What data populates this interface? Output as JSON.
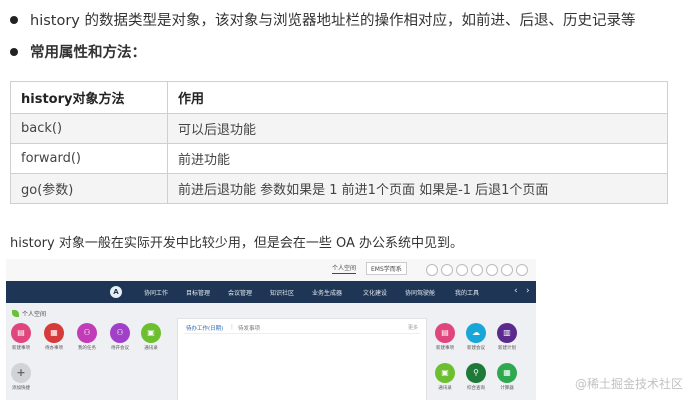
{
  "bullets": [
    "history 的数据类型是对象，该对象与浏览器地址栏的操作相对应，如前进、后退、历史记录等",
    "常用属性和方法："
  ],
  "table": {
    "headers": [
      "history对象方法",
      "作用"
    ],
    "rows": [
      [
        "back()",
        "可以后退功能"
      ],
      [
        "forward()",
        "前进功能"
      ],
      [
        "go(参数)",
        "前进后退功能 参数如果是 1 前进1个页面 如果是-1 后退1个页面"
      ]
    ]
  },
  "note": "history 对象一般在实际开发中比较少用，但是会在一些 OA 办公系统中见到。",
  "oa": {
    "tabs": [
      "个人空间",
      "EMS学而系"
    ],
    "logo_letter": "A",
    "nav_items": [
      "协同工作",
      "目标管理",
      "会议管理",
      "知识社区",
      "业务生成器",
      "文化建设",
      "协同驾驶舱",
      "我的工具"
    ],
    "nav_prev": "‹",
    "nav_next": "›",
    "section_title": "个人空间",
    "left_apps": [
      {
        "label": "新建事项",
        "color": "#e0457b",
        "glyph": "▤"
      },
      {
        "label": "待办事项",
        "color": "#d63a3a",
        "glyph": "▦"
      },
      {
        "label": "我的任务",
        "color": "#c23cb8",
        "glyph": "⚇"
      },
      {
        "label": "待开会议",
        "color": "#a040c8",
        "glyph": "⚇"
      },
      {
        "label": "通讯录",
        "color": "#6cbf2e",
        "glyph": "▣"
      }
    ],
    "add_label": "添加快捷",
    "add_glyph": "+",
    "panel_tabs": [
      "待办工作(日期)",
      "待发事项"
    ],
    "panel_sep": "|",
    "panel_more": "更多",
    "right_apps": [
      {
        "label": "新建事项",
        "color": "#e0457b",
        "glyph": "▤"
      },
      {
        "label": "新建会议",
        "color": "#18a6d8",
        "glyph": "☁"
      },
      {
        "label": "新建计划",
        "color": "#5b2a8c",
        "glyph": "▥"
      },
      {
        "label": "通讯录",
        "color": "#6cbf2e",
        "glyph": "▣"
      },
      {
        "label": "综合查询",
        "color": "#1f7a3a",
        "glyph": "⚲"
      },
      {
        "label": "计算器",
        "color": "#2fa84f",
        "glyph": "▦"
      }
    ]
  },
  "watermark": "@稀土掘金技术社区"
}
